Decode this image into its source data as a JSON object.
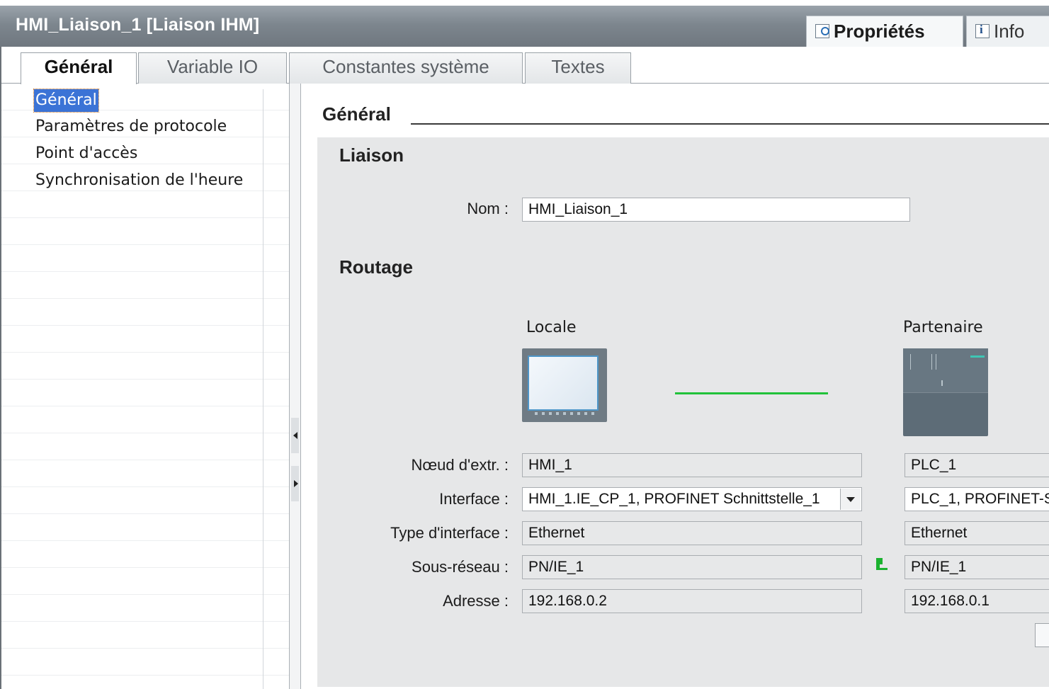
{
  "window": {
    "title": "HMI_Liaison_1 [Liaison IHM]",
    "properties_tab": "Propriétés",
    "info_tab": "Info"
  },
  "tabs": [
    {
      "label": "Général",
      "active": true
    },
    {
      "label": "Variable IO",
      "active": false
    },
    {
      "label": "Constantes système",
      "active": false
    },
    {
      "label": "Textes",
      "active": false
    }
  ],
  "nav": {
    "items": [
      {
        "label": "Général",
        "selected": true
      },
      {
        "label": "Paramètres de protocole",
        "selected": false
      },
      {
        "label": "Point d'accès",
        "selected": false
      },
      {
        "label": "Synchronisation de l'heure",
        "selected": false
      }
    ]
  },
  "main": {
    "section_title": "Général",
    "connection": {
      "heading": "Liaison",
      "name_label": "Nom :",
      "name_value": "HMI_Liaison_1"
    },
    "routing": {
      "heading": "Routage",
      "local_header": "Locale",
      "partner_header": "Partenaire",
      "labels": {
        "node": "Nœud d'extr. :",
        "interface": "Interface :",
        "interface_type": "Type d'interface :",
        "subnet": "Sous-réseau :",
        "address": "Adresse :"
      },
      "local": {
        "node": "HMI_1",
        "interface": "HMI_1.IE_CP_1, PROFINET Schnittstelle_1",
        "interface_type": "Ethernet",
        "subnet": "PN/IE_1",
        "address": "192.168.0.2"
      },
      "partner": {
        "node": "PLC_1",
        "interface": "PLC_1, PROFINET-S",
        "interface_type": "Ethernet",
        "subnet": "PN/IE_1",
        "address": "192.168.0.1"
      }
    }
  },
  "colors": {
    "selection": "#3b73d6",
    "link_line": "#21c23a",
    "panel_bg": "#e6e7e8",
    "title_bar": "#7d868e"
  }
}
